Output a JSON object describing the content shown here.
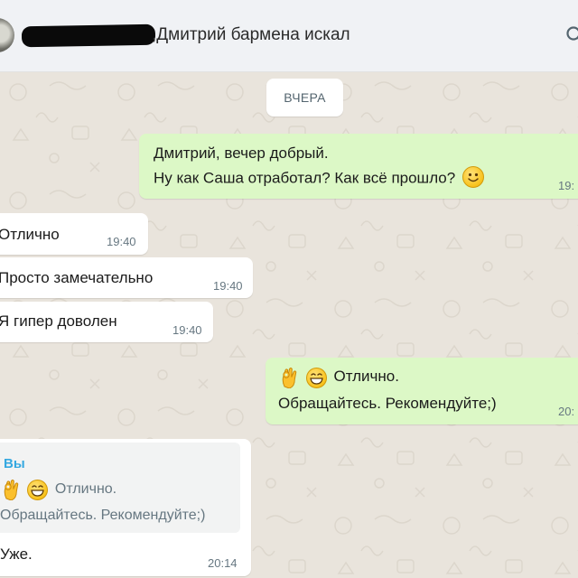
{
  "header": {
    "chat_title": ",Дмитрий бармена искал",
    "avatar_icon": "contact-avatar",
    "search_icon": "search-icon"
  },
  "date_divider": "ВЧЕРА",
  "messages": [
    {
      "direction": "outgoing",
      "lines": [
        "Дмитрий, вечер добрый.",
        "Ну как Саша отработал? Как всё прошло?"
      ],
      "emoji": "slightly-smiling-face",
      "time": "19:"
    },
    {
      "direction": "incoming",
      "text": "Отлично",
      "time": "19:40"
    },
    {
      "direction": "incoming",
      "text": "Просто замечательно",
      "time": "19:40"
    },
    {
      "direction": "incoming",
      "text": "Я гипер доволен",
      "time": "19:40"
    },
    {
      "direction": "outgoing",
      "emojis": [
        "ok-hand",
        "grinning-face"
      ],
      "lines": [
        "Отлично.",
        "Обращайтесь. Рекомендуйте;)"
      ],
      "time": "20:"
    },
    {
      "direction": "incoming",
      "reply_to": {
        "author": "Вы",
        "emojis": [
          "ok-hand",
          "grinning-face"
        ],
        "lines": [
          "Отлично.",
          "Обращайтесь. Рекомендуйте;)"
        ]
      },
      "text": "Уже.",
      "time": "20:14"
    }
  ],
  "colors": {
    "outgoing_bubble": "#dcf8c6",
    "incoming_bubble": "#ffffff",
    "wallpaper": "#e9e4dc",
    "quote_accent": "#53bdeb",
    "quote_author": "#35a8e0"
  }
}
